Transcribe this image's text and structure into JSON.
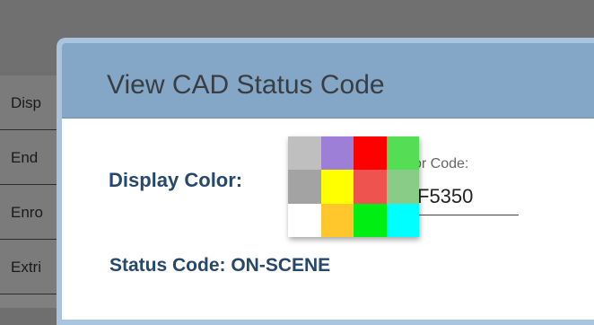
{
  "background_list": {
    "items": [
      {
        "label": "Disp"
      },
      {
        "label": "End "
      },
      {
        "label": "Enro"
      },
      {
        "label": "Extri"
      }
    ]
  },
  "modal": {
    "title": "View CAD Status Code",
    "display_color_label": "Display Color:",
    "color_code_label": "or Code:",
    "color_code_value": "F5350",
    "status_code_label": "Status Code: ON-SCENE",
    "swatches": [
      "#bfbfbf",
      "#9e7fd8",
      "#ff0000",
      "#55dd55",
      "#a3a3a3",
      "#ffff00",
      "#ee5350",
      "#88cc88",
      "#ffffff",
      "#ffc72c",
      "#00ee11",
      "#00ffff"
    ]
  }
}
